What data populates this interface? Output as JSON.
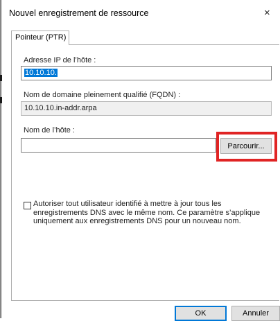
{
  "dialog": {
    "title": "Nouvel enregistrement de ressource",
    "close_glyph": "×"
  },
  "tab": {
    "label": "Pointeur (PTR)"
  },
  "form": {
    "ip_label": "Adresse IP de l’hôte :",
    "ip_value": "10.10.10.",
    "fqdn_label": "Nom de domaine pleinement qualifié (FQDN) :",
    "fqdn_value": "10.10.10.in-addr.arpa",
    "host_label": "Nom de l’hôte :",
    "host_value": "",
    "browse_label": "Parcourir...",
    "checkbox_checked": false,
    "checkbox_text": "Autoriser tout utilisateur identifié à mettre à jour tous les enregistrements DNS avec le même nom. Ce paramètre s’applique uniquement aux enregistrements DNS pour un nouveau nom."
  },
  "footer": {
    "ok_label": "OK",
    "cancel_label": "Annuler"
  },
  "colors": {
    "highlight": "#e02424",
    "selection": "#0078d7"
  }
}
